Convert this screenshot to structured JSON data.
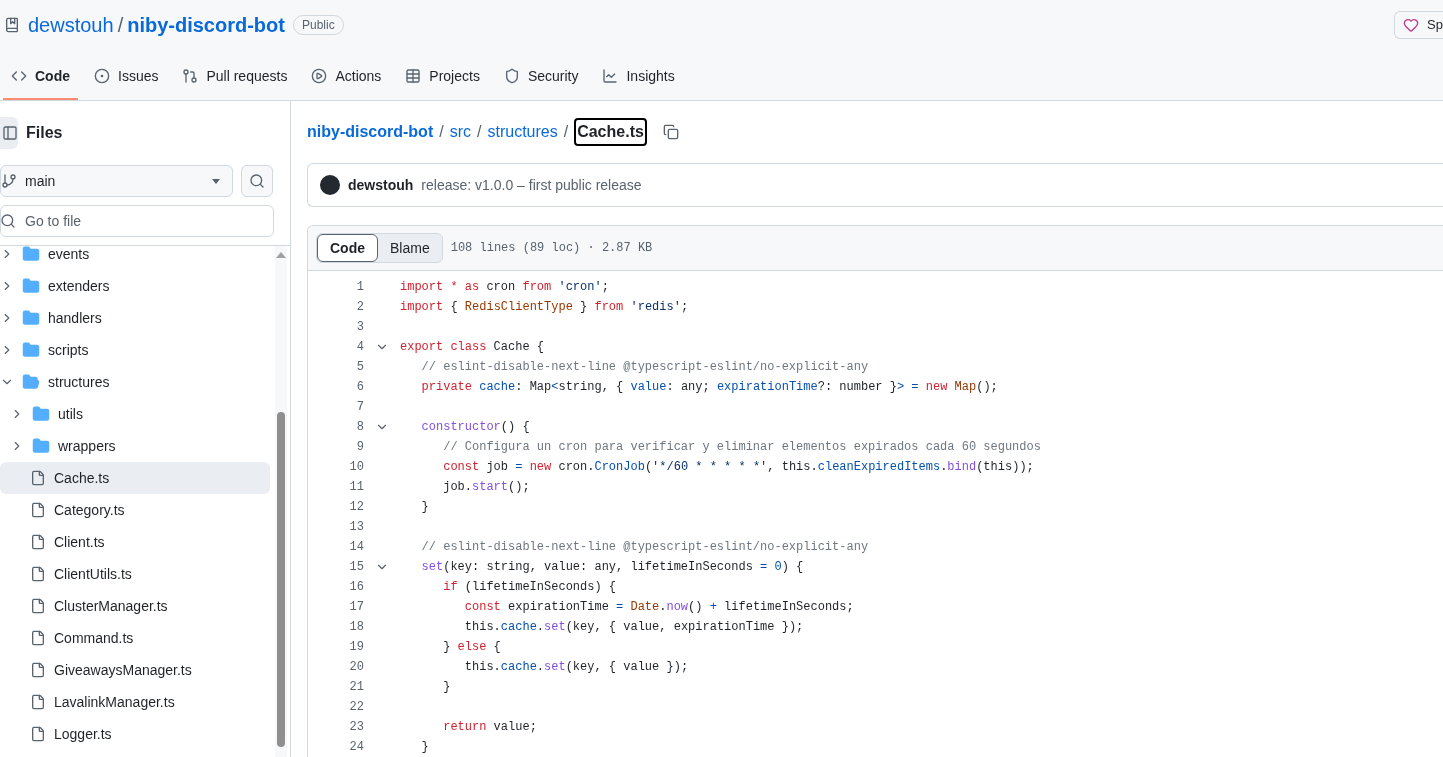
{
  "repo": {
    "owner": "dewstouh",
    "separator": "/",
    "name": "niby-discord-bot",
    "visibility": "Public"
  },
  "sponsor_button": {
    "label": "Sp"
  },
  "tabs": [
    {
      "label": "Code",
      "selected": true
    },
    {
      "label": "Issues",
      "selected": false
    },
    {
      "label": "Pull requests",
      "selected": false
    },
    {
      "label": "Actions",
      "selected": false
    },
    {
      "label": "Projects",
      "selected": false
    },
    {
      "label": "Security",
      "selected": false
    },
    {
      "label": "Insights",
      "selected": false
    }
  ],
  "sidebar": {
    "title": "Files",
    "branch": "main",
    "search": {
      "placeholder": "Go to file"
    },
    "tree": [
      {
        "name": "events",
        "kind": "folder",
        "expanded": false,
        "selected": false
      },
      {
        "name": "extenders",
        "kind": "folder",
        "expanded": false,
        "selected": false
      },
      {
        "name": "handlers",
        "kind": "folder",
        "expanded": false,
        "selected": false
      },
      {
        "name": "scripts",
        "kind": "folder",
        "expanded": false,
        "selected": false
      },
      {
        "name": "structures",
        "kind": "folder",
        "expanded": true,
        "selected": false,
        "children": [
          {
            "name": "utils",
            "kind": "folder",
            "expanded": false,
            "selected": false
          },
          {
            "name": "wrappers",
            "kind": "folder",
            "expanded": false,
            "selected": false
          },
          {
            "name": "Cache.ts",
            "kind": "file",
            "selected": true
          },
          {
            "name": "Category.ts",
            "kind": "file",
            "selected": false
          },
          {
            "name": "Client.ts",
            "kind": "file",
            "selected": false
          },
          {
            "name": "ClientUtils.ts",
            "kind": "file",
            "selected": false
          },
          {
            "name": "ClusterManager.ts",
            "kind": "file",
            "selected": false
          },
          {
            "name": "Command.ts",
            "kind": "file",
            "selected": false
          },
          {
            "name": "GiveawaysManager.ts",
            "kind": "file",
            "selected": false
          },
          {
            "name": "LavalinkManager.ts",
            "kind": "file",
            "selected": false
          },
          {
            "name": "Logger.ts",
            "kind": "file",
            "selected": false
          }
        ]
      }
    ]
  },
  "breadcrumb": {
    "parts": [
      "niby-discord-bot",
      "src",
      "structures"
    ],
    "separator": "/",
    "current": "Cache.ts"
  },
  "commit": {
    "author": "dewstouh",
    "message": "release: v1.0.0 – first public release"
  },
  "file_view": {
    "tabs": [
      {
        "label": "Code",
        "selected": true
      },
      {
        "label": "Blame",
        "selected": false
      }
    ],
    "info": "108 lines (89 loc) · 2.87 KB",
    "lines": [
      {
        "number": "1",
        "foldable": false,
        "tokens": [
          {
            "kind": "keyword",
            "text": "import * as"
          },
          {
            "kind": "plain",
            "text": " cron "
          },
          {
            "kind": "keyword",
            "text": "from "
          },
          {
            "kind": "string",
            "text": "'cron'"
          },
          {
            "kind": "plain",
            "text": ";"
          }
        ]
      },
      {
        "number": "2",
        "foldable": false,
        "tokens": [
          {
            "kind": "keyword",
            "text": "import"
          },
          {
            "kind": "plain",
            "text": " { "
          },
          {
            "kind": "type",
            "text": "RedisClientType"
          },
          {
            "kind": "plain",
            "text": " } "
          },
          {
            "kind": "keyword",
            "text": "from "
          },
          {
            "kind": "string",
            "text": "'redis'"
          },
          {
            "kind": "plain",
            "text": ";"
          }
        ]
      },
      {
        "number": "3",
        "foldable": false
      },
      {
        "number": "4",
        "foldable": true,
        "tokens": [
          {
            "kind": "keyword",
            "text": "export class"
          },
          {
            "kind": "plain",
            "text": " Cache {"
          }
        ]
      },
      {
        "number": "5",
        "foldable": false,
        "tokens": [
          {
            "kind": "comment",
            "text": "   // eslint-disable-next-line @typescript-eslint/no-explicit-any"
          }
        ]
      },
      {
        "number": "6",
        "foldable": false,
        "tokens": [
          {
            "kind": "keyword",
            "text": "   private "
          },
          {
            "kind": "property",
            "text": "cache"
          },
          {
            "kind": "plain",
            "text": ": Map"
          },
          {
            "kind": "property",
            "text": "<"
          },
          {
            "kind": "plain",
            "text": "string, { "
          },
          {
            "kind": "property",
            "text": "value"
          },
          {
            "kind": "plain",
            "text": ": any; "
          },
          {
            "kind": "property",
            "text": "expirationTime"
          },
          {
            "kind": "plain",
            "text": "?: number }"
          },
          {
            "kind": "property",
            "text": "> = "
          },
          {
            "kind": "keyword",
            "text": "new "
          },
          {
            "kind": "type",
            "text": "Map"
          },
          {
            "kind": "plain",
            "text": "();"
          }
        ]
      },
      {
        "number": "7",
        "foldable": false
      },
      {
        "number": "8",
        "foldable": true,
        "tokens": [
          {
            "kind": "function",
            "text": "   constructor"
          },
          {
            "kind": "plain",
            "text": "() {"
          }
        ]
      },
      {
        "number": "9",
        "foldable": false,
        "tokens": [
          {
            "kind": "comment",
            "text": "      // Configura un cron para verificar y eliminar elementos expirados cada 60 segundos"
          }
        ]
      },
      {
        "number": "10",
        "foldable": false,
        "tokens": [
          {
            "kind": "keyword",
            "text": "      const"
          },
          {
            "kind": "plain",
            "text": " job "
          },
          {
            "kind": "property",
            "text": "= "
          },
          {
            "kind": "keyword",
            "text": "new"
          },
          {
            "kind": "plain",
            "text": " cron."
          },
          {
            "kind": "property",
            "text": "CronJob"
          },
          {
            "kind": "plain",
            "text": "("
          },
          {
            "kind": "string",
            "text": "'*/60 * * * * *'"
          },
          {
            "kind": "plain",
            "text": ", this."
          },
          {
            "kind": "property",
            "text": "cleanExpiredItems"
          },
          {
            "kind": "plain",
            "text": "."
          },
          {
            "kind": "function",
            "text": "bind"
          },
          {
            "kind": "plain",
            "text": "(this));"
          }
        ]
      },
      {
        "number": "11",
        "foldable": false,
        "tokens": [
          {
            "kind": "plain",
            "text": "      job."
          },
          {
            "kind": "function",
            "text": "start"
          },
          {
            "kind": "plain",
            "text": "();"
          }
        ]
      },
      {
        "number": "12",
        "foldable": false,
        "tokens": [
          {
            "kind": "plain",
            "text": "   }"
          }
        ]
      },
      {
        "number": "13",
        "foldable": false
      },
      {
        "number": "14",
        "foldable": false,
        "tokens": [
          {
            "kind": "comment",
            "text": "   // eslint-disable-next-line @typescript-eslint/no-explicit-any"
          }
        ]
      },
      {
        "number": "15",
        "foldable": true,
        "tokens": [
          {
            "kind": "function",
            "text": "   set"
          },
          {
            "kind": "plain",
            "text": "(key: string, value: any, lifetimeInSeconds "
          },
          {
            "kind": "property",
            "text": "= 0"
          },
          {
            "kind": "plain",
            "text": ") {"
          }
        ]
      },
      {
        "number": "16",
        "foldable": false,
        "tokens": [
          {
            "kind": "keyword",
            "text": "      if"
          },
          {
            "kind": "plain",
            "text": " (lifetimeInSeconds) {"
          }
        ]
      },
      {
        "number": "17",
        "foldable": false,
        "tokens": [
          {
            "kind": "keyword",
            "text": "         const"
          },
          {
            "kind": "plain",
            "text": " expirationTime "
          },
          {
            "kind": "property",
            "text": "= "
          },
          {
            "kind": "type",
            "text": "Date"
          },
          {
            "kind": "plain",
            "text": "."
          },
          {
            "kind": "function",
            "text": "now"
          },
          {
            "kind": "plain",
            "text": "() "
          },
          {
            "kind": "property",
            "text": "+"
          },
          {
            "kind": "plain",
            "text": " lifetimeInSeconds;"
          }
        ]
      },
      {
        "number": "18",
        "foldable": false,
        "tokens": [
          {
            "kind": "plain",
            "text": "         this."
          },
          {
            "kind": "property",
            "text": "cache"
          },
          {
            "kind": "plain",
            "text": "."
          },
          {
            "kind": "function",
            "text": "set"
          },
          {
            "kind": "plain",
            "text": "(key, { value, expirationTime });"
          }
        ]
      },
      {
        "number": "19",
        "foldable": false,
        "tokens": [
          {
            "kind": "plain",
            "text": "      } "
          },
          {
            "kind": "keyword",
            "text": "else"
          },
          {
            "kind": "plain",
            "text": " {"
          }
        ]
      },
      {
        "number": "20",
        "foldable": false,
        "tokens": [
          {
            "kind": "plain",
            "text": "         this."
          },
          {
            "kind": "property",
            "text": "cache"
          },
          {
            "kind": "plain",
            "text": "."
          },
          {
            "kind": "function",
            "text": "set"
          },
          {
            "kind": "plain",
            "text": "(key, { value });"
          }
        ]
      },
      {
        "number": "21",
        "foldable": false,
        "tokens": [
          {
            "kind": "plain",
            "text": "      }"
          }
        ]
      },
      {
        "number": "22",
        "foldable": false
      },
      {
        "number": "23",
        "foldable": false,
        "tokens": [
          {
            "kind": "keyword",
            "text": "      return"
          },
          {
            "kind": "plain",
            "text": " value;"
          }
        ]
      },
      {
        "number": "24",
        "foldable": false,
        "tokens": [
          {
            "kind": "plain",
            "text": "   }"
          }
        ]
      }
    ]
  }
}
